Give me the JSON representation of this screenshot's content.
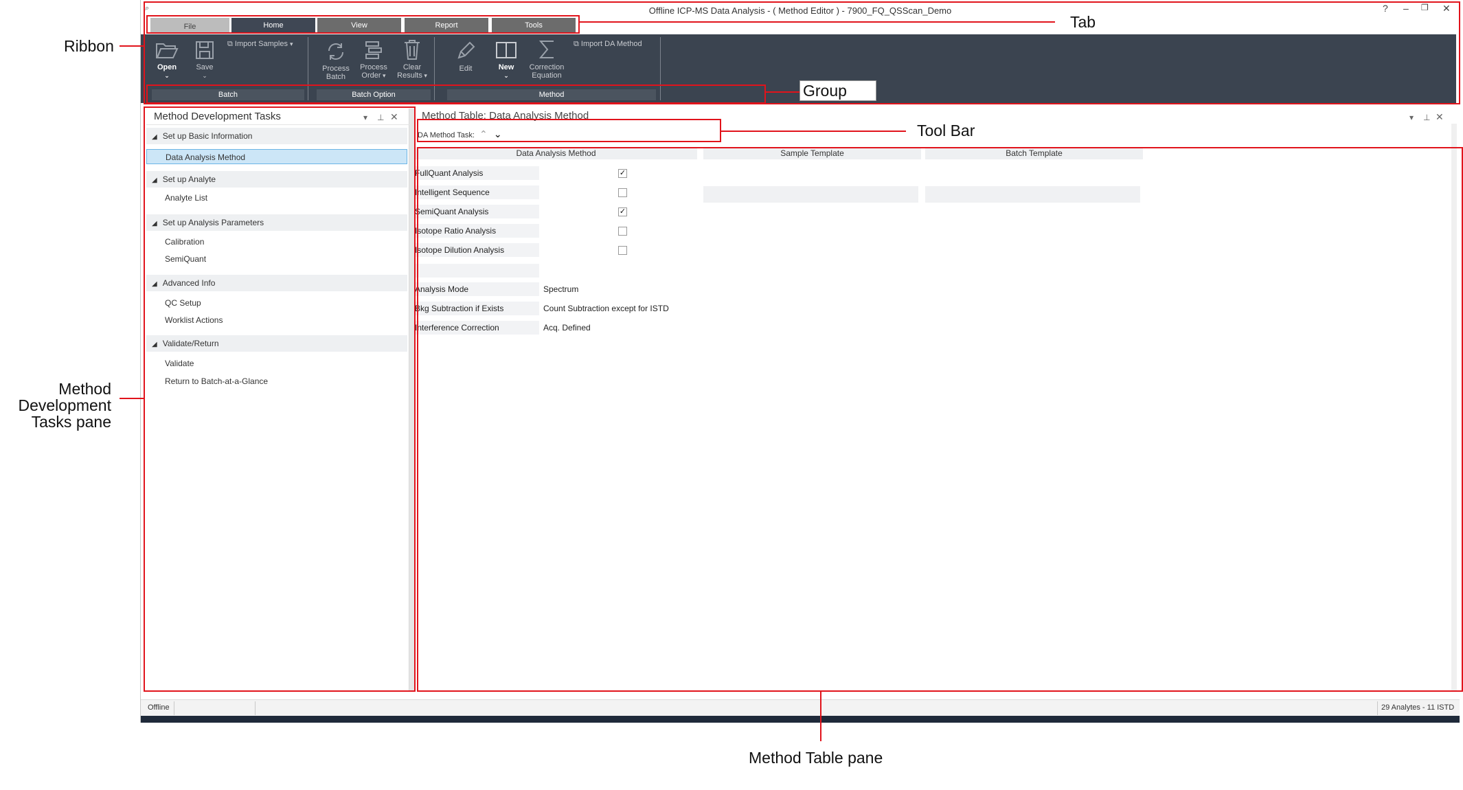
{
  "window": {
    "title": "Offline ICP-MS Data Analysis - ( Method Editor ) - 7900_FQ_QSScan_Demo",
    "help": "?",
    "minimize": "–",
    "restore": "❐",
    "close": "✕"
  },
  "tabs": [
    {
      "label": "File"
    },
    {
      "label": "Home"
    },
    {
      "label": "View"
    },
    {
      "label": "Report"
    },
    {
      "label": "Tools"
    }
  ],
  "ribbon": {
    "open": "Open",
    "save": "Save",
    "import_samples": "Import Samples",
    "process_batch_1": "Process",
    "process_batch_2": "Batch",
    "process_order_1": "Process",
    "process_order_2": "Order",
    "clear_results_1": "Clear",
    "clear_results_2": "Results",
    "edit": "Edit",
    "new": "New",
    "correction_equation_1": "Correction",
    "correction_equation_2": "Equation",
    "import_da_method": "Import DA Method",
    "groups": [
      "Batch",
      "Batch Option",
      "Method"
    ]
  },
  "task_pane": {
    "title": "Method Development Tasks",
    "sections": [
      {
        "label": "Set up Basic Information",
        "items": [
          "Data Analysis Method"
        ]
      },
      {
        "label": "Set up Analyte",
        "items": [
          "Analyte List"
        ]
      },
      {
        "label": "Set up Analysis Parameters",
        "items": [
          "Calibration",
          "SemiQuant"
        ]
      },
      {
        "label": "Advanced Info",
        "items": [
          "QC Setup",
          "Worklist Actions"
        ]
      },
      {
        "label": "Validate/Return",
        "items": [
          "Validate",
          "Return to Batch-at-a-Glance"
        ]
      }
    ]
  },
  "method_pane": {
    "title": "Method Table: Data Analysis Method",
    "toolbar_label": "DA Method Task:",
    "columns": [
      "Data Analysis Method",
      "Sample Template",
      "Batch Template"
    ],
    "check_rows": [
      {
        "label": "FullQuant Analysis",
        "checked": true
      },
      {
        "label": "Intelligent Sequence",
        "checked": false
      },
      {
        "label": "SemiQuant Analysis",
        "checked": true
      },
      {
        "label": "Isotope Ratio Analysis",
        "checked": false
      },
      {
        "label": "Isotope Dilution Analysis",
        "checked": false
      }
    ],
    "value_rows": [
      {
        "label": "Analysis Mode",
        "value": "Spectrum"
      },
      {
        "label": "Bkg Subtraction if Exists",
        "value": "Count Subtraction except for ISTD"
      },
      {
        "label": "Interference Correction",
        "value": "Acq. Defined"
      }
    ]
  },
  "status_bar": {
    "left": "Offline",
    "right": "29 Analytes - 11 ISTD"
  },
  "annotations": {
    "ribbon": "Ribbon",
    "tab": "Tab",
    "group": "Group",
    "tool_bar": "Tool Bar",
    "tasks_pane_1": "Method",
    "tasks_pane_2": "Development",
    "tasks_pane_3": "Tasks pane",
    "method_table_pane": "Method Table pane"
  },
  "colors": {
    "ribbon_bg": "#3b4450",
    "active_tab": "#3f4754",
    "callout_red": "#e1131b",
    "selected_item": "#cce6f7"
  }
}
